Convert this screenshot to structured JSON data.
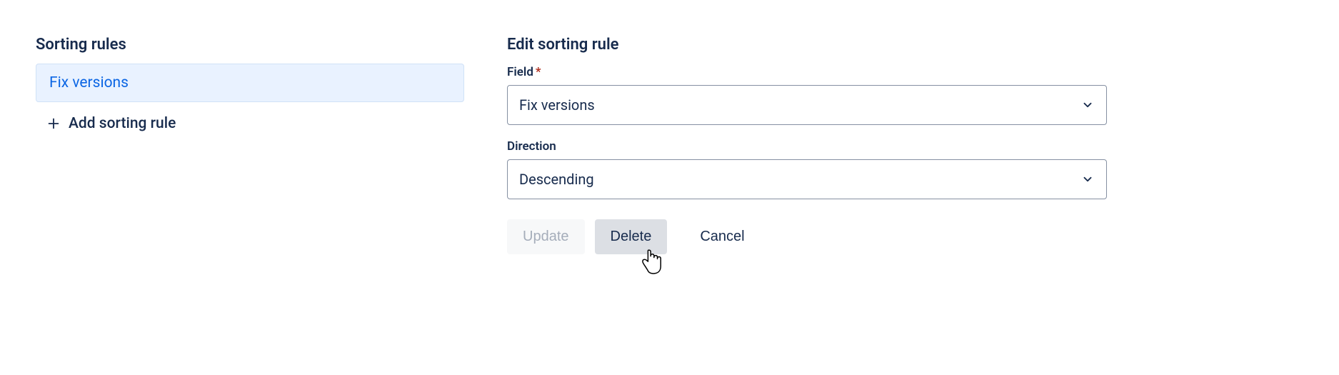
{
  "left": {
    "title": "Sorting rules",
    "rules": [
      {
        "label": "Fix versions"
      }
    ],
    "add_label": "Add sorting rule"
  },
  "right": {
    "title": "Edit sorting rule",
    "field_label": "Field",
    "field_required_mark": "*",
    "field_value": "Fix versions",
    "direction_label": "Direction",
    "direction_value": "Descending",
    "buttons": {
      "update": "Update",
      "delete": "Delete",
      "cancel": "Cancel"
    }
  }
}
